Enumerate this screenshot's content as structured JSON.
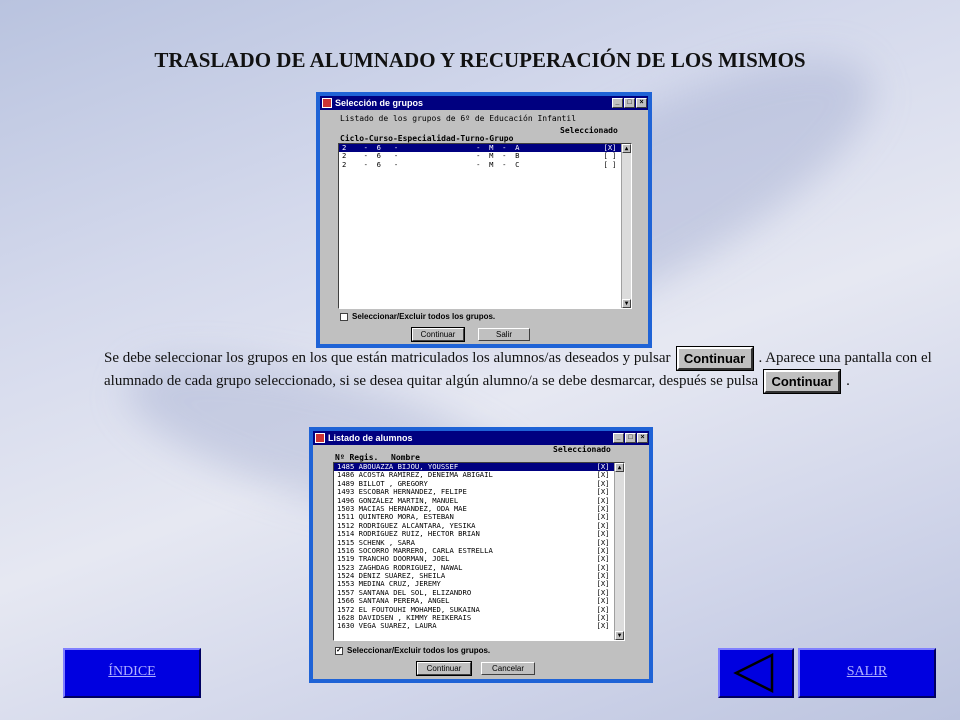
{
  "page": {
    "title": "TRASLADO DE ALUMNADO Y RECUPERACIÓN DE LOS MISMOS",
    "paragraph": {
      "part1": "Se debe seleccionar los grupos en los que están matriculados los alumnos/as deseados y pulsar",
      "part2": ". Aparece una pantalla con el alumnado de cada grupo seleccionado, si se desea quitar algún alumno/a se debe desmarcar, después se pulsa",
      "part3": ".",
      "button_label": "Continuar"
    },
    "nav": {
      "index_label": "ÍNDICE",
      "exit_label": "SALIR",
      "back_icon": "left-triangle-icon"
    },
    "accent": "#0000e0"
  },
  "groups_window": {
    "title": "Selección de grupos",
    "subtitle": "Listado de los grupos de 6º de Educación Infantil",
    "selected_header": "Seleccionado",
    "column_header": "Ciclo-Curso-Especialidad-Turno-Grupo",
    "rows": [
      {
        "text": "2    -  6   -                  -  M  -  A",
        "mark": "[X]",
        "selected": true
      },
      {
        "text": "2    -  6   -                  -  M  -  B",
        "mark": "[ ]",
        "selected": false
      },
      {
        "text": "2    -  6   -                  -  M  -  C",
        "mark": "[ ]",
        "selected": false
      }
    ],
    "select_all_label": "Seleccionar/Excluir todos los grupos.",
    "continue_label": "Continuar",
    "exit_label": "Salir"
  },
  "students_window": {
    "title": "Listado de alumnos",
    "selected_header": "Seleccionado",
    "col_regis": "Nº Regis.",
    "col_name": "Nombre",
    "rows": [
      {
        "text": "1485 ABOUAZZA BIJOU, YOUSSEF",
        "mark": "[X]",
        "selected": true
      },
      {
        "text": "1486 ACOSTA RAMÍREZ, DENEIMA ABIGAIL",
        "mark": "[X]"
      },
      {
        "text": "1489 BILLOT , GREGORY",
        "mark": "[X]"
      },
      {
        "text": "1493 ESCOBAR HERNÁNDEZ, FELIPE",
        "mark": "[X]"
      },
      {
        "text": "1496 GONZÁLEZ MARTÍN, MANUEL",
        "mark": "[X]"
      },
      {
        "text": "1503 MACÍAS HERNÁNDEZ, ODA MAE",
        "mark": "[X]"
      },
      {
        "text": "1511 QUINTERO MORA, ESTEBAN",
        "mark": "[X]"
      },
      {
        "text": "1512 RODRÍGUEZ ALCÁNTARA, YESIKA",
        "mark": "[X]"
      },
      {
        "text": "1514 RODRÍGUEZ RUÍZ, HECTOR BRIAN",
        "mark": "[X]"
      },
      {
        "text": "1515 SCHENK , SARA",
        "mark": "[X]"
      },
      {
        "text": "1516 SOCORRO MARRERO, CARLA ESTRELLA",
        "mark": "[X]"
      },
      {
        "text": "1519 TRANCHO DOORMAN, JOEL",
        "mark": "[X]"
      },
      {
        "text": "1523 ZAGHDAG RODRIGUEZ, NAWAL",
        "mark": "[X]"
      },
      {
        "text": "1524 DÉNIZ SUÁREZ, SHEILA",
        "mark": "[X]"
      },
      {
        "text": "1553 MEDINA CRUZ, JEREMY",
        "mark": "[X]"
      },
      {
        "text": "1557 SANTANA DEL SOL, ELIZANDRO",
        "mark": "[X]"
      },
      {
        "text": "1566 SANTANA PERERA, ÁNGEL",
        "mark": "[X]"
      },
      {
        "text": "1572 EL FOUTOUHI MOHAMED, SUKAINA",
        "mark": "[X]"
      },
      {
        "text": "1628 DAVIDSEN , KIMMY REIKERAIS",
        "mark": "[X]"
      },
      {
        "text": "1630 VEGA SUAREZ, LAURA",
        "mark": "[X]"
      }
    ],
    "select_all_label": "Seleccionar/Excluir todos los grupos.",
    "select_all_checked": "✓",
    "continue_label": "Continuar",
    "cancel_label": "Cancelar"
  }
}
